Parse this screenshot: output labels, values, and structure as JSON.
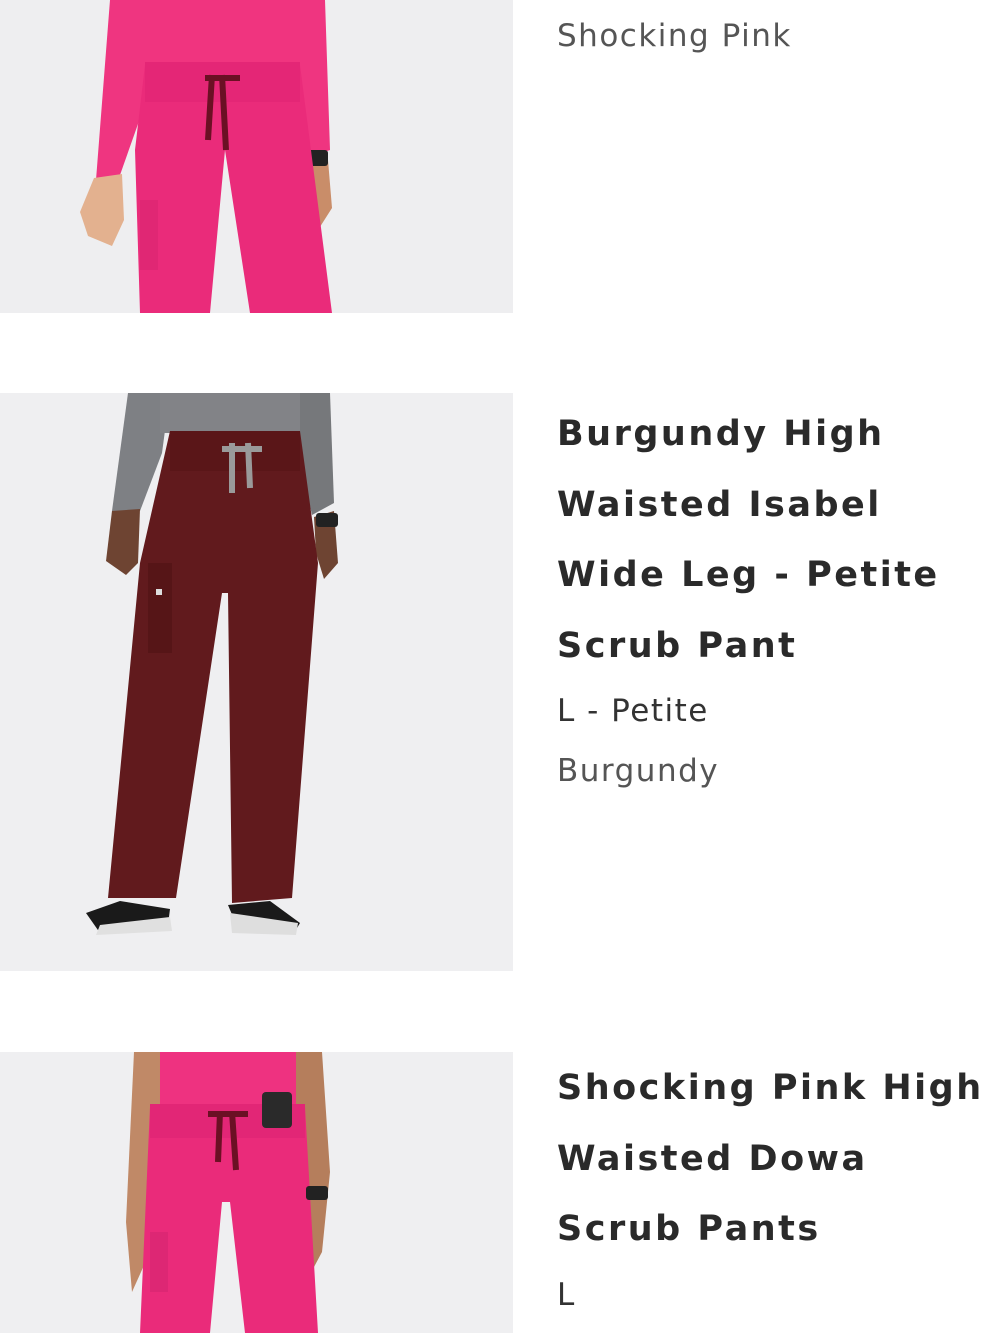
{
  "items": [
    {
      "title": "",
      "size": "",
      "color_name": "Shocking Pink",
      "image": {
        "top_color": "#f0327f",
        "pant_color": "#ee2f7e",
        "drawstring": "#6b1024"
      }
    },
    {
      "title": "Burgundy High Waisted Isabel Wide Leg - Petite Scrub Pant",
      "size": "L - Petite",
      "color_name": "Burgundy",
      "image": {
        "top_color": "#7d7f82",
        "pant_color": "#621a1d",
        "drawstring": "#9a9a9a"
      }
    },
    {
      "title": "Shocking Pink High Waisted Dowa Scrub Pants",
      "size": "L",
      "color_name": "",
      "image": {
        "top_color": "#f0327f",
        "pant_color": "#ee2f7e",
        "drawstring": "#6b1024"
      }
    }
  ]
}
